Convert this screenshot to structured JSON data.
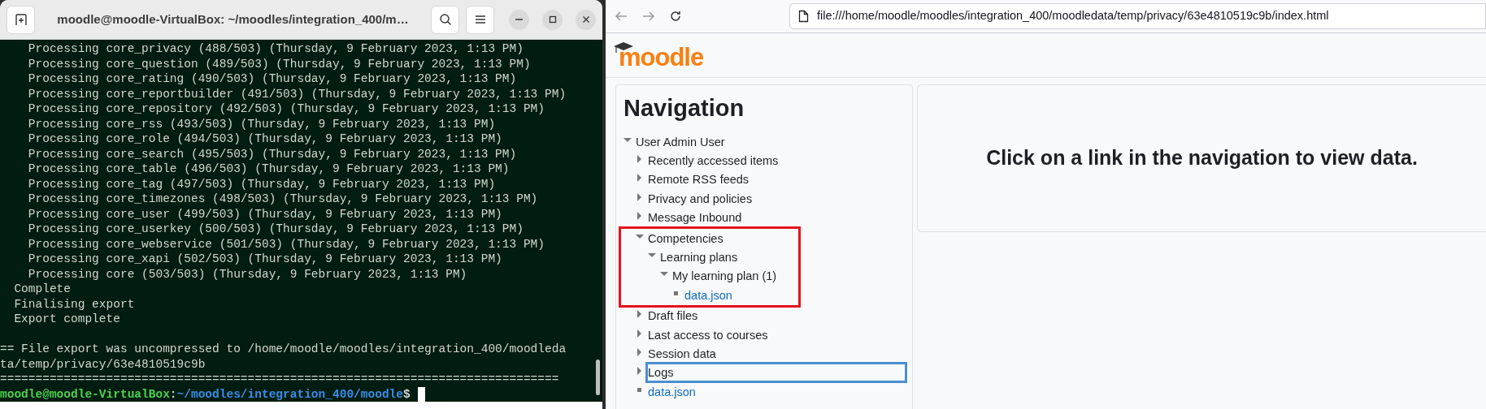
{
  "terminal": {
    "title": "moodle@moodle-VirtualBox: ~/moodles/integration_400/m…",
    "blocks": [
      {
        "lines": [
          "    Processing core_privacy (488/503) (Thursday, 9 February 2023, 1:13 PM)",
          "    Processing core_question (489/503) (Thursday, 9 February 2023, 1:13 PM)",
          "    Processing core_rating (490/503) (Thursday, 9 February 2023, 1:13 PM)",
          "    Processing core_reportbuilder (491/503) (Thursday, 9 February 2023, 1:13 PM)",
          "    Processing core_repository (492/503) (Thursday, 9 February 2023, 1:13 PM)",
          "    Processing core_rss (493/503) (Thursday, 9 February 2023, 1:13 PM)",
          "    Processing core_role (494/503) (Thursday, 9 February 2023, 1:13 PM)",
          "    Processing core_search (495/503) (Thursday, 9 February 2023, 1:13 PM)",
          "    Processing core_table (496/503) (Thursday, 9 February 2023, 1:13 PM)",
          "    Processing core_tag (497/503) (Thursday, 9 February 2023, 1:13 PM)",
          "    Processing core_timezones (498/503) (Thursday, 9 February 2023, 1:13 PM)",
          "    Processing core_user (499/503) (Thursday, 9 February 2023, 1:13 PM)",
          "    Processing core_userkey (500/503) (Thursday, 9 February 2023, 1:13 PM)",
          "    Processing core_webservice (501/503) (Thursday, 9 February 2023, 1:13 PM)",
          "    Processing core_xapi (502/503) (Thursday, 9 February 2023, 1:13 PM)",
          "    Processing core (503/503) (Thursday, 9 February 2023, 1:13 PM)",
          "  Complete",
          "  Finalising export",
          "  Export complete"
        ]
      },
      {
        "lines": [
          "== File export was uncompressed to /home/moodle/moodles/integration_400/moodleda",
          "ta/temp/privacy/63e4810519c9b",
          "==============================================================================="
        ]
      }
    ],
    "prompt": {
      "user_host": "moodle@moodle-VirtualBox",
      "separator": ":",
      "path": "~/moodles/integration_400/moodle",
      "symbol": "$"
    }
  },
  "browser": {
    "url": "file:///home/moodle/moodles/integration_400/moodledata/temp/privacy/63e4810519c9b/index.html",
    "logo": "moodle",
    "navigation": {
      "title": "Navigation",
      "tree": [
        {
          "label": "User Admin User",
          "kind": "branch",
          "expanded": true,
          "highlighted": false,
          "focused": false,
          "children": [
            {
              "label": "Recently accessed items",
              "kind": "branch",
              "expanded": false,
              "highlighted": false,
              "focused": false
            },
            {
              "label": "Remote RSS feeds",
              "kind": "branch",
              "expanded": false,
              "highlighted": false,
              "focused": false
            },
            {
              "label": "Privacy and policies",
              "kind": "branch",
              "expanded": false,
              "highlighted": false,
              "focused": false
            },
            {
              "label": "Message Inbound",
              "kind": "branch",
              "expanded": false,
              "highlighted": false,
              "focused": false
            },
            {
              "label": "Competencies",
              "kind": "branch",
              "expanded": true,
              "highlighted": true,
              "focused": false,
              "children": [
                {
                  "label": "Learning plans",
                  "kind": "branch",
                  "expanded": true,
                  "highlighted": false,
                  "focused": false,
                  "children": [
                    {
                      "label": "My learning plan (1)",
                      "kind": "branch",
                      "expanded": true,
                      "highlighted": false,
                      "focused": false,
                      "children": [
                        {
                          "label": "data.json",
                          "kind": "file",
                          "highlighted": false,
                          "focused": false
                        }
                      ]
                    }
                  ]
                }
              ]
            },
            {
              "label": "Draft files",
              "kind": "branch",
              "expanded": false,
              "highlighted": false,
              "focused": false
            },
            {
              "label": "Last access to courses",
              "kind": "branch",
              "expanded": false,
              "highlighted": false,
              "focused": false
            },
            {
              "label": "Session data",
              "kind": "branch",
              "expanded": false,
              "highlighted": false,
              "focused": false
            },
            {
              "label": "Logs",
              "kind": "branch",
              "expanded": false,
              "highlighted": false,
              "focused": true
            },
            {
              "label": "data.json",
              "kind": "file",
              "highlighted": false,
              "focused": false
            }
          ]
        }
      ]
    },
    "message": "Click on a link in the navigation to view data."
  }
}
